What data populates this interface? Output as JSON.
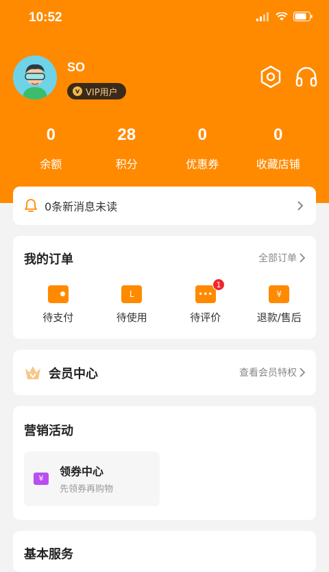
{
  "status_bar": {
    "time": "10:52"
  },
  "profile": {
    "username": "SO",
    "vip_label": "VIP用户",
    "vip_icon": "v",
    "avatar": "avatar-icon"
  },
  "header_icons": [
    "settings-hexagon-icon",
    "headset-icon"
  ],
  "stats": [
    {
      "value": "0",
      "label": "余额"
    },
    {
      "value": "28",
      "label": "积分"
    },
    {
      "value": "0",
      "label": "优惠券"
    },
    {
      "value": "0",
      "label": "收藏店铺"
    }
  ],
  "messages": {
    "text": "0条新消息未读"
  },
  "orders": {
    "title": "我的订单",
    "all_link": "全部订单",
    "items": [
      {
        "label": "待支付",
        "icon": "wallet-icon",
        "glyph": ""
      },
      {
        "label": "待使用",
        "icon": "ticket-icon",
        "glyph": "L"
      },
      {
        "label": "待评价",
        "icon": "chat-icon",
        "glyph": "•••",
        "badge": "1"
      },
      {
        "label": "退款/售后",
        "icon": "refund-icon",
        "glyph": "¥"
      }
    ]
  },
  "vip_center": {
    "title": "会员中心",
    "link": "查看会员特权"
  },
  "marketing": {
    "title": "营销活动",
    "coupon_center": {
      "title": "领券中心",
      "subtitle": "先领券再购物",
      "glyph": "¥"
    }
  },
  "services": {
    "title": "基本服务"
  },
  "colors": {
    "brand": "#ff8a00",
    "badge": "#f0282d",
    "coupon": "#b84ef0"
  }
}
